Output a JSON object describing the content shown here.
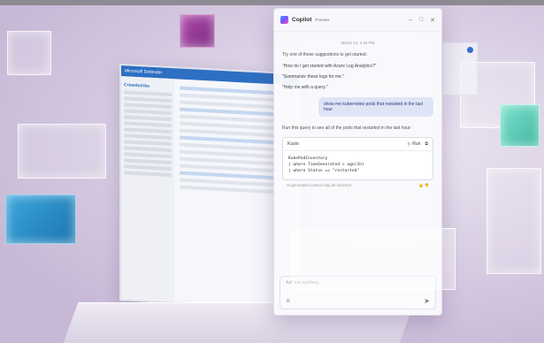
{
  "laptop": {
    "title": "Microsoft Defender",
    "heading": "Crowdstrike"
  },
  "copilot": {
    "name": "Copilot",
    "badge": "Preview",
    "timestamp": "March 14, 2:34 PM",
    "intro": "Try one of these suggestions to get started:",
    "suggestions": [
      "\"How do I get started with Azure Log Analytics?\"",
      "\"Summarize these logs for me.\"",
      "\"Help me with a query.\""
    ],
    "user_message": "show me kubernetes pods that restarted in the last hour",
    "reply_intro": "Run this query to see all of the pods that restarted in the last hour:",
    "code_language": "Kusto",
    "run_label": "Run",
    "code_lines": [
      "KubePodInventory",
      "| where TimeGenerated > ago(1h)",
      "| where Status == \"restarted\""
    ],
    "card_footer": "AI-generated content may be incorrect",
    "input_placeholder": "Ask me anything..."
  },
  "icons": {
    "minimize": "minimize-icon",
    "maximize": "maximize-icon",
    "close": "close-icon",
    "send": "send-icon",
    "attach": "attach-icon",
    "copy": "copy-icon"
  },
  "colors": {
    "accent": "#2d6fc2",
    "cube_pink": "#b14aa8",
    "cube_blue": "#1c74b0",
    "cube_teal": "#3fb7a1"
  }
}
